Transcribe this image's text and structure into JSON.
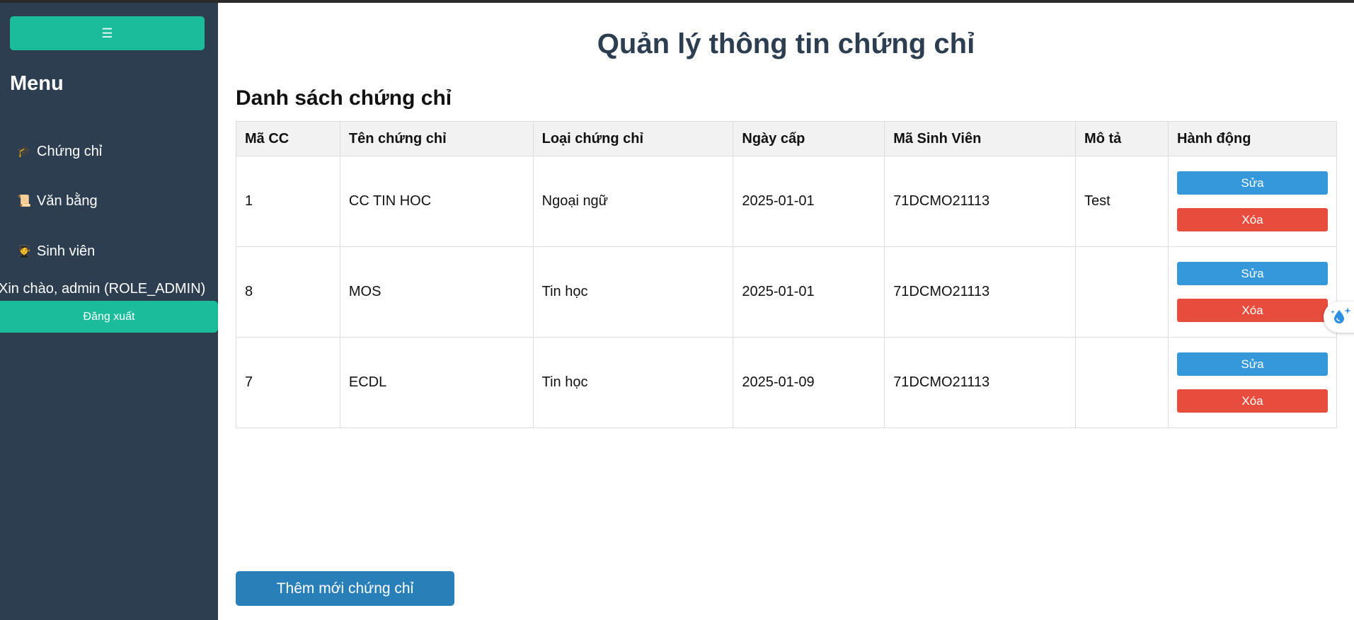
{
  "sidebar": {
    "toggle_icon": "☰",
    "menu_title": "Menu",
    "items": [
      {
        "icon": "graduation-cap-icon",
        "glyph": "🎓",
        "label": "Chứng chỉ"
      },
      {
        "icon": "scroll-icon",
        "glyph": "📜",
        "label": "Văn bằng"
      },
      {
        "icon": "student-icon",
        "glyph": "🧑‍🎓",
        "label": "Sinh viên"
      }
    ],
    "greeting": "Xin chào, admin (ROLE_ADMIN)",
    "logout_label": "Đăng xuất"
  },
  "main": {
    "page_title": "Quản lý thông tin chứng chỉ",
    "section_title": "Danh sách chứng chỉ",
    "table": {
      "headers": [
        "Mã CC",
        "Tên chứng chỉ",
        "Loại chứng chỉ",
        "Ngày cấp",
        "Mã Sinh Viên",
        "Mô tả",
        "Hành động"
      ],
      "rows": [
        {
          "id": "1",
          "name": "CC TIN HOC",
          "type": "Ngoại ngữ",
          "date": "2025-01-01",
          "student_id": "71DCMO21113",
          "desc": "Test"
        },
        {
          "id": "8",
          "name": "MOS",
          "type": "Tin học",
          "date": "2025-01-01",
          "student_id": "71DCMO21113",
          "desc": ""
        },
        {
          "id": "7",
          "name": "ECDL",
          "type": "Tin học",
          "date": "2025-01-09",
          "student_id": "71DCMO21113",
          "desc": ""
        }
      ],
      "edit_label": "Sửa",
      "delete_label": "Xóa"
    },
    "add_button_label": "Thêm mới chứng chỉ"
  },
  "colors": {
    "sidebar_bg": "#2c3e50",
    "accent_teal": "#1abc9c",
    "edit_blue": "#3498db",
    "delete_red": "#e74c3c",
    "add_blue": "#2980b9"
  }
}
